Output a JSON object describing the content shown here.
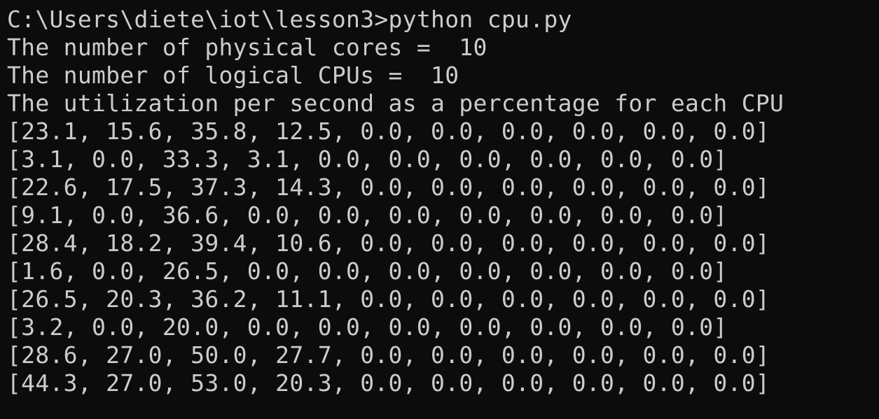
{
  "terminal": {
    "lines": [
      "C:\\Users\\diete\\iot\\lesson3>python cpu.py",
      "The number of physical cores =  10",
      "The number of logical CPUs =  10",
      "The utilization per second as a percentage for each CPU",
      "[23.1, 15.6, 35.8, 12.5, 0.0, 0.0, 0.0, 0.0, 0.0, 0.0]",
      "[3.1, 0.0, 33.3, 3.1, 0.0, 0.0, 0.0, 0.0, 0.0, 0.0]",
      "[22.6, 17.5, 37.3, 14.3, 0.0, 0.0, 0.0, 0.0, 0.0, 0.0]",
      "[9.1, 0.0, 36.6, 0.0, 0.0, 0.0, 0.0, 0.0, 0.0, 0.0]",
      "[28.4, 18.2, 39.4, 10.6, 0.0, 0.0, 0.0, 0.0, 0.0, 0.0]",
      "[1.6, 0.0, 26.5, 0.0, 0.0, 0.0, 0.0, 0.0, 0.0, 0.0]",
      "[26.5, 20.3, 36.2, 11.1, 0.0, 0.0, 0.0, 0.0, 0.0, 0.0]",
      "[3.2, 0.0, 20.0, 0.0, 0.0, 0.0, 0.0, 0.0, 0.0, 0.0]",
      "[28.6, 27.0, 50.0, 27.7, 0.0, 0.0, 0.0, 0.0, 0.0, 0.0]",
      "[44.3, 27.0, 53.0, 20.3, 0.0, 0.0, 0.0, 0.0, 0.0, 0.0]"
    ]
  },
  "colors": {
    "background": "#0c0c0c",
    "foreground": "#cccccc"
  }
}
